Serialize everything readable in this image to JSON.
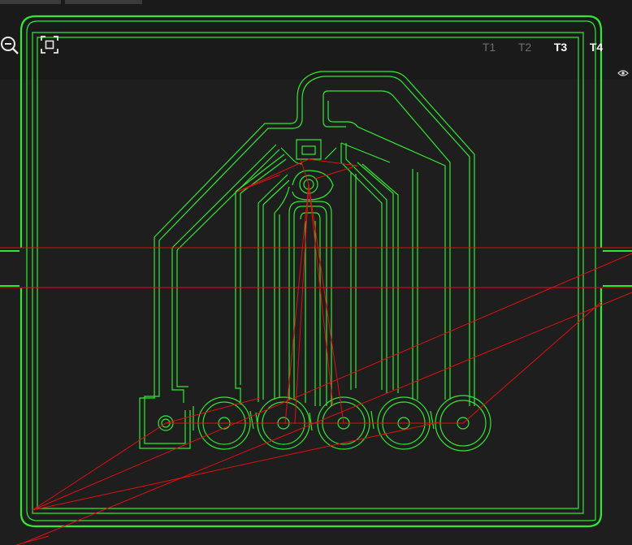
{
  "toolbar": {
    "zoom_out_icon": "zoom-out-icon",
    "fit_icon": "fit-to-view-icon"
  },
  "layers": {
    "tabs": [
      {
        "label": "T1",
        "state": "inactive"
      },
      {
        "label": "T2",
        "state": "inactive"
      },
      {
        "label": "T3",
        "state": "active"
      },
      {
        "label": "T4",
        "state": "active"
      }
    ],
    "visibility_icon": "eye-icon"
  },
  "colors": {
    "background": "#1e1e1e",
    "outline": "#33e833",
    "ratsnest": "#e01010",
    "tab_inactive": "#6d6d6d",
    "tab_active": "#ffffff"
  }
}
